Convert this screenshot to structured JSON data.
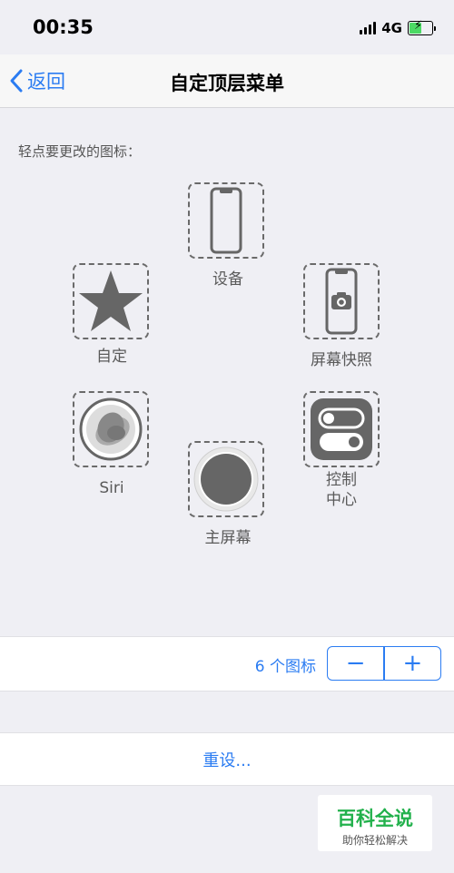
{
  "status_bar": {
    "time": "00:35",
    "network": "4G"
  },
  "nav": {
    "back_label": "返回",
    "title": "自定顶层菜单"
  },
  "instruction": "轻点要更改的图标：",
  "slots": {
    "device": {
      "label": "设备",
      "icon": "phone-icon"
    },
    "custom": {
      "label": "自定",
      "icon": "star-icon"
    },
    "screenshot": {
      "label": "屏幕快照",
      "icon": "camera-phone-icon"
    },
    "siri": {
      "label": "Siri",
      "icon": "siri-icon"
    },
    "control_center": {
      "label_line1": "控制",
      "label_line2": "中心",
      "icon": "toggles-icon"
    },
    "home": {
      "label": "主屏幕",
      "icon": "home-button-icon"
    }
  },
  "stepper": {
    "count_label": "6 个图标",
    "minus": "−",
    "plus": "+"
  },
  "reset": {
    "label": "重设..."
  },
  "watermark": {
    "title": "百科全说",
    "subtitle": "助你轻松解决"
  },
  "colors": {
    "accent": "#2b7cf2",
    "background": "#efeff4",
    "icon_gray": "#6a6a6a",
    "watermark_green": "#22b14c"
  }
}
